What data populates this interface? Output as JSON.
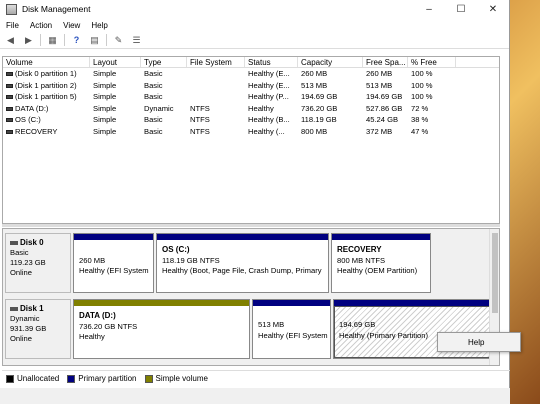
{
  "window": {
    "title": "Disk Management"
  },
  "menu": [
    "File",
    "Action",
    "View",
    "Help"
  ],
  "columns": [
    "Volume",
    "Layout",
    "Type",
    "File System",
    "Status",
    "Capacity",
    "Free Spa...",
    "% Free"
  ],
  "volumes": [
    [
      "(Disk 0 partition 1)",
      "Simple",
      "Basic",
      "",
      "Healthy (E...",
      "260 MB",
      "260 MB",
      "100 %"
    ],
    [
      "(Disk 1 partition 2)",
      "Simple",
      "Basic",
      "",
      "Healthy (E...",
      "513 MB",
      "513 MB",
      "100 %"
    ],
    [
      "(Disk 1 partition 5)",
      "Simple",
      "Basic",
      "",
      "Healthy (P...",
      "194.69 GB",
      "194.69 GB",
      "100 %"
    ],
    [
      "DATA (D:)",
      "Simple",
      "Dynamic",
      "NTFS",
      "Healthy",
      "736.20 GB",
      "527.86 GB",
      "72 %"
    ],
    [
      "OS (C:)",
      "Simple",
      "Basic",
      "NTFS",
      "Healthy (B...",
      "118.19 GB",
      "45.24 GB",
      "38 %"
    ],
    [
      "RECOVERY",
      "Simple",
      "Basic",
      "NTFS",
      "Healthy (...",
      "800 MB",
      "372 MB",
      "47 %"
    ]
  ],
  "disks": [
    {
      "name": "Disk 0",
      "type": "Basic",
      "size": "119.23 GB",
      "state": "Online",
      "partitions": [
        {
          "title": "",
          "line1": "260 MB",
          "line2": "Healthy (EFI System"
        },
        {
          "title": "OS  (C:)",
          "line1": "118.19 GB NTFS",
          "line2": "Healthy (Boot, Page File, Crash Dump, Primary"
        },
        {
          "title": "RECOVERY",
          "line1": "800 MB NTFS",
          "line2": "Healthy (OEM Partition)"
        }
      ]
    },
    {
      "name": "Disk 1",
      "type": "Dynamic",
      "size": "931.39 GB",
      "state": "Online",
      "partitions": [
        {
          "title": "DATA  (D:)",
          "line1": "736.20 GB NTFS",
          "line2": "Healthy"
        },
        {
          "title": "",
          "line1": "513 MB",
          "line2": "Healthy (EFI System"
        },
        {
          "title": "",
          "line1": "194.69 GB",
          "line2": "Healthy (Primary Partition)"
        }
      ]
    }
  ],
  "legend": [
    {
      "label": "Unallocated",
      "color": "#000000"
    },
    {
      "label": "Primary partition",
      "color": "#000080"
    },
    {
      "label": "Simple volume",
      "color": "#808000"
    }
  ],
  "context_menu": {
    "item": "Help"
  },
  "colors": {
    "primary": "#000080",
    "simple": "#808000",
    "unallocated": "#000000"
  }
}
